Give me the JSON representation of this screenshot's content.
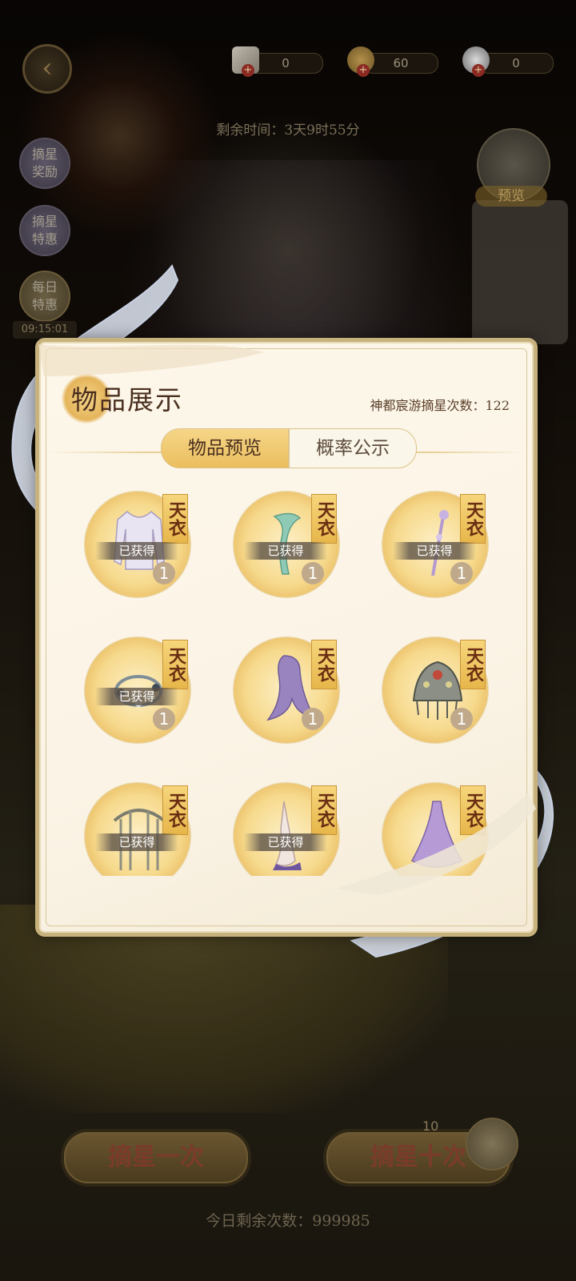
{
  "topbar": {
    "currencies": [
      {
        "icon": "ticket-icon",
        "value": "0"
      },
      {
        "icon": "coin-icon",
        "value": "60"
      },
      {
        "icon": "pearl-icon",
        "value": "0"
      }
    ],
    "remaining_time": "剩余时间：3天9时55分"
  },
  "side_menu": [
    {
      "label": "摘星奖励"
    },
    {
      "label": "摘星特惠"
    },
    {
      "label": "每日特惠"
    }
  ],
  "side_date": "09:15:01",
  "preview_label": "预览",
  "modal": {
    "title": "物品展示",
    "draw_count": "神都宸游摘星次数：122",
    "tabs": [
      {
        "label": "物品预览",
        "active": true
      },
      {
        "label": "概率公示",
        "active": false
      }
    ],
    "items": [
      {
        "kind": "blouse",
        "tag": "天衣",
        "obtained": "已获得",
        "qty": "1"
      },
      {
        "kind": "sash",
        "tag": "天衣",
        "obtained": "已获得",
        "qty": "1"
      },
      {
        "kind": "hairpin",
        "tag": "天衣",
        "obtained": "已获得",
        "qty": "1"
      },
      {
        "kind": "bracelet",
        "tag": "天衣",
        "obtained": "已获得",
        "qty": "1"
      },
      {
        "kind": "hair",
        "tag": "天衣",
        "obtained": "",
        "qty": "1"
      },
      {
        "kind": "crown",
        "tag": "天衣",
        "obtained": "",
        "qty": "1"
      },
      {
        "kind": "headdress",
        "tag": "天衣",
        "obtained": "已获得",
        "qty": ""
      },
      {
        "kind": "shoes",
        "tag": "天衣",
        "obtained": "已获得",
        "qty": ""
      },
      {
        "kind": "gown",
        "tag": "天衣",
        "obtained": "",
        "qty": ""
      }
    ]
  },
  "bottom": {
    "draw_once": "摘星一次",
    "draw_ten": "摘星十次",
    "draw_ten_count": "10",
    "today_remaining": "今日剩余次数：999985"
  }
}
